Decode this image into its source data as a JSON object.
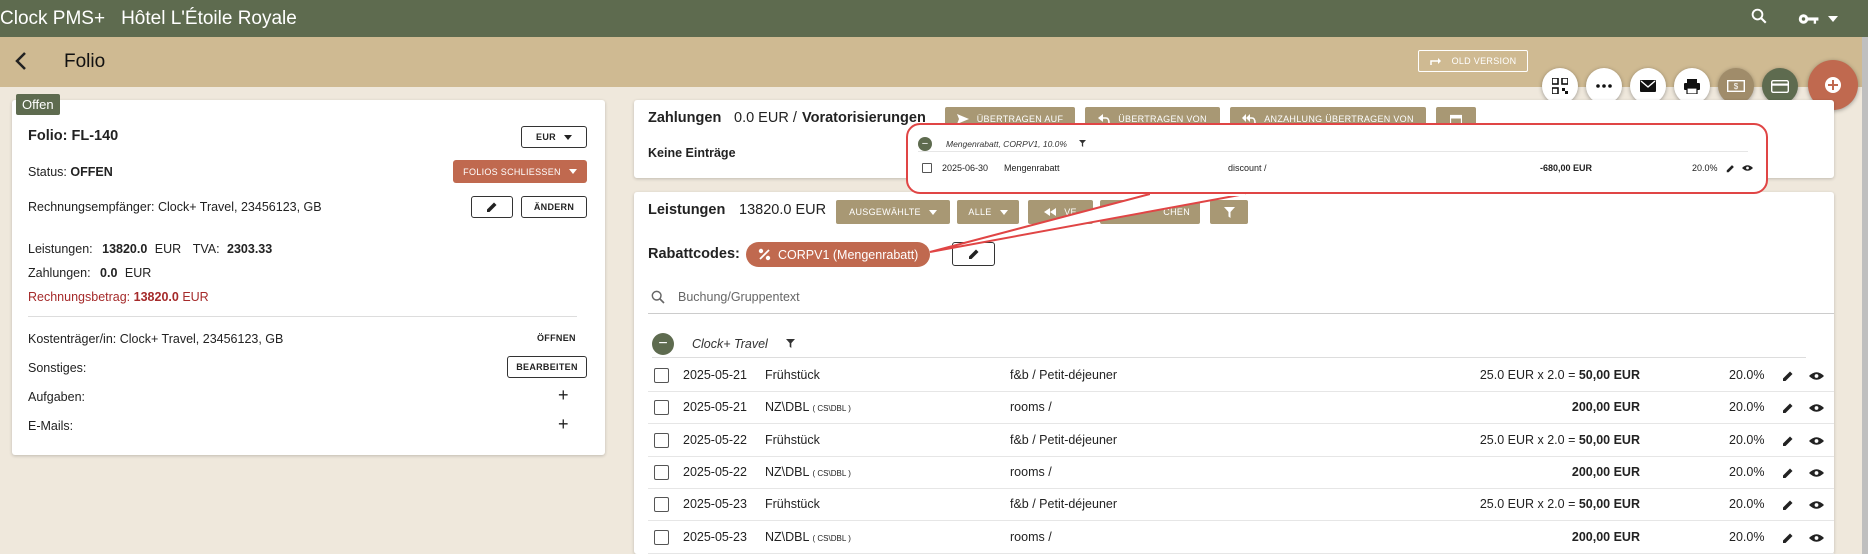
{
  "topbar": {
    "brand": "Clock PMS+",
    "hotel": "Hôtel L'Étoile Royale"
  },
  "subbar": {
    "title": "Folio",
    "old_version": "OLD VERSION"
  },
  "folio": {
    "tag": "Offen",
    "title": "Folio: FL-140",
    "currency": "EUR",
    "status_label": "Status:",
    "status_value": "OFFEN",
    "close_btn": "FOLIOS SCHLIESSEN",
    "recipient_label": "Rechnungsempfänger:",
    "recipient_value": "Clock+ Travel, 23456123, GB",
    "change_btn": "ÄNDERN",
    "leistungen_label": "Leistungen:",
    "leistungen_value": "13820.0",
    "leistungen_cur": "EUR",
    "tva_label": "TVA:",
    "tva_value": "2303.33",
    "zahlungen_label": "Zahlungen:",
    "zahlungen_value": "0.0",
    "zahlungen_cur": "EUR",
    "rechnung_label": "Rechnungsbetrag:",
    "rechnung_value": "13820.0",
    "rechnung_cur": "EUR",
    "kosten_label": "Kostenträger/in:",
    "kosten_value": "Clock+ Travel, 23456123, GB",
    "open_btn": "ÖFFNEN",
    "sonstiges_label": "Sonstiges:",
    "edit_btn": "BEARBEITEN",
    "aufgaben_label": "Aufgaben:",
    "emails_label": "E-Mails:",
    "plus": "+"
  },
  "zahlungen": {
    "title": "Zahlungen",
    "amount": "0.0 EUR /",
    "vorauth": "Voratorisierungen",
    "btn_uebertragen_auf": "ÜBERTRAGEN AUF",
    "btn_uebertragen_von": "ÜBERTRAGEN VON",
    "btn_anzahlung": "ANZAHLUNG ÜBERTRAGEN VON",
    "empty": "Keine Einträge"
  },
  "leistungen": {
    "title": "Leistungen",
    "amount": "13820.0 EUR",
    "btn_ausgewaehlte": "AUSGEWÄHLTE",
    "btn_alle": "ALLE",
    "btn_ve": "VE",
    "btn_chen": "CHEN",
    "rabatt_label": "Rabattcodes:",
    "rabatt_chip": "CORPV1 (Mengenrabatt)",
    "search_placeholder": "Buchung/Gruppentext",
    "group": "Clock+ Travel",
    "rows": [
      {
        "date": "2025-05-21",
        "name": "Frühstück",
        "code": "",
        "cat": "f&b / Petit-déjeuner",
        "calc": "25.0 EUR x 2.0 = ",
        "total": "50,00 EUR",
        "vat": "20.0%"
      },
      {
        "date": "2025-05-21",
        "name": "NZ\\DBL",
        "code": "( CS\\DBL )",
        "cat": "rooms /",
        "calc": "",
        "total": "200,00 EUR",
        "vat": "20.0%"
      },
      {
        "date": "2025-05-22",
        "name": "Frühstück",
        "code": "",
        "cat": "f&b / Petit-déjeuner",
        "calc": "25.0 EUR x 2.0 = ",
        "total": "50,00 EUR",
        "vat": "20.0%"
      },
      {
        "date": "2025-05-22",
        "name": "NZ\\DBL",
        "code": "( CS\\DBL )",
        "cat": "rooms /",
        "calc": "",
        "total": "200,00 EUR",
        "vat": "20.0%"
      },
      {
        "date": "2025-05-23",
        "name": "Frühstück",
        "code": "",
        "cat": "f&b / Petit-déjeuner",
        "calc": "25.0 EUR x 2.0 = ",
        "total": "50,00 EUR",
        "vat": "20.0%"
      },
      {
        "date": "2025-05-23",
        "name": "NZ\\DBL",
        "code": "( CS\\DBL )",
        "cat": "rooms /",
        "calc": "",
        "total": "200,00 EUR",
        "vat": "20.0%"
      }
    ]
  },
  "popup": {
    "group": "Mengenrabatt, CORPV1, 10.0%",
    "date": "2025-06-30",
    "name": "Mengenrabatt",
    "cat": "discount /",
    "total": "-680,00 EUR",
    "vat": "20.0%"
  },
  "colors": {
    "olive": "#5e6b4f",
    "tan": "#cfba92",
    "accent": "#c0694f",
    "highlight": "#e04545"
  }
}
